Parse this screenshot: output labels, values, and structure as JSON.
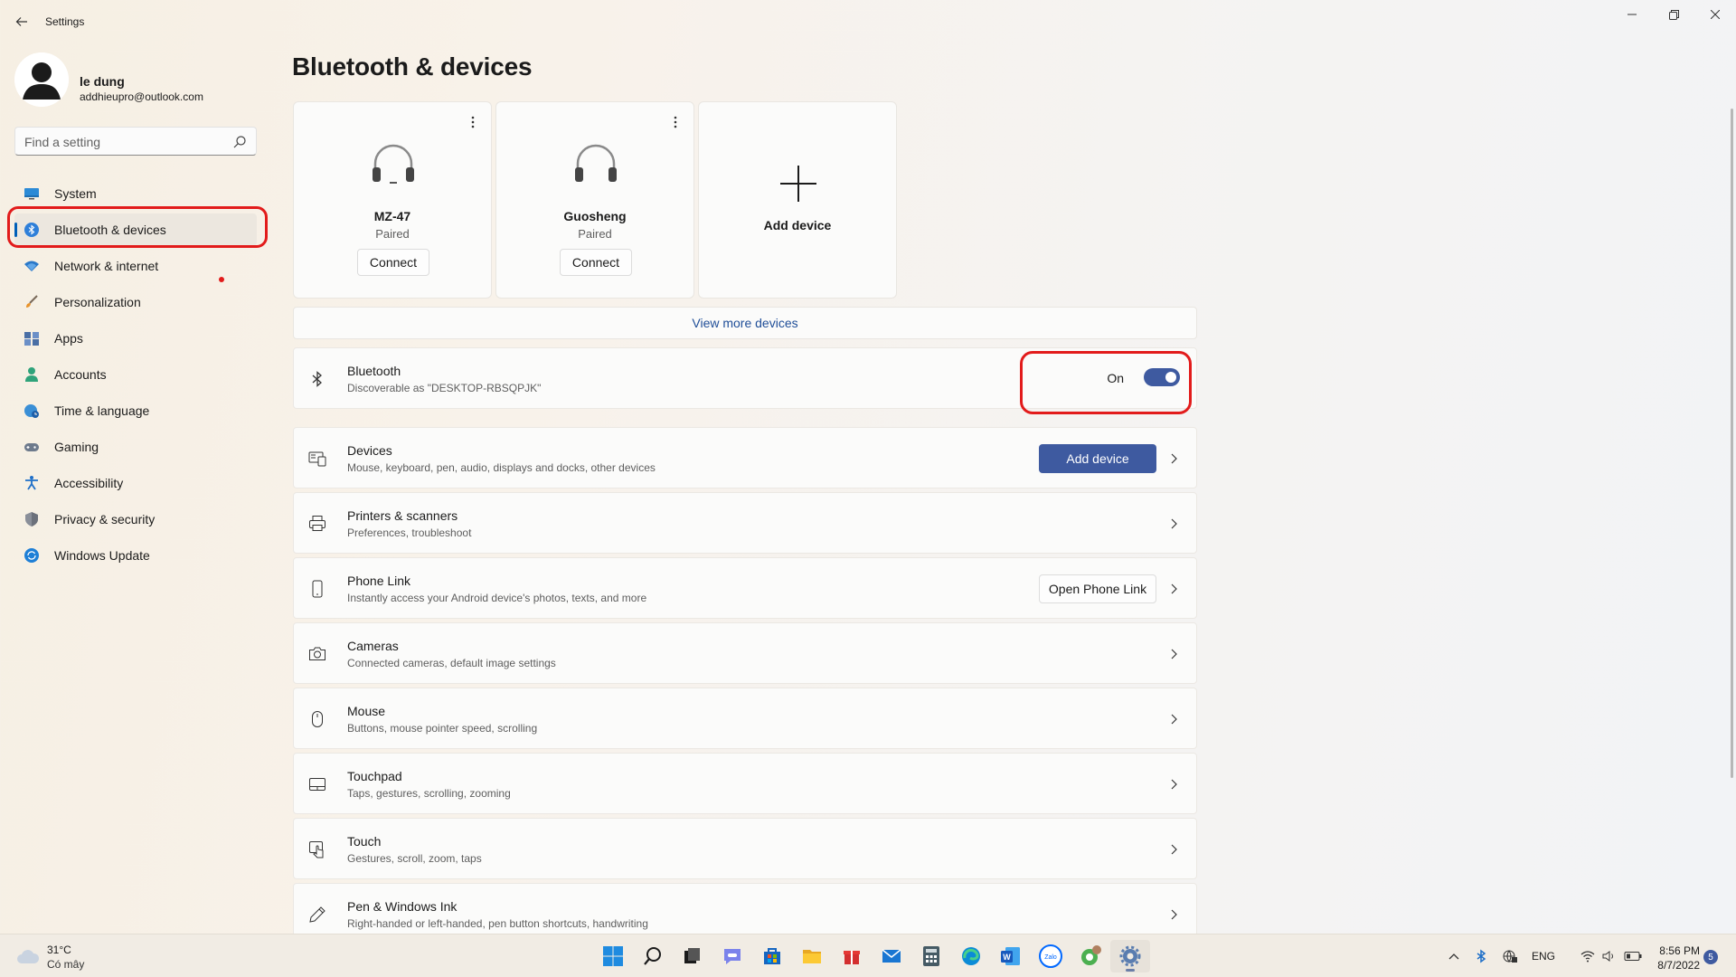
{
  "window": {
    "title": "Settings"
  },
  "profile": {
    "name": "le dung",
    "email": "addhieupro@outlook.com"
  },
  "search": {
    "placeholder": "Find a setting"
  },
  "nav": [
    {
      "label": "System",
      "icon": "monitor-icon"
    },
    {
      "label": "Bluetooth & devices",
      "icon": "bluetooth-icon",
      "active": true
    },
    {
      "label": "Network & internet",
      "icon": "wifi-icon"
    },
    {
      "label": "Personalization",
      "icon": "brush-icon"
    },
    {
      "label": "Apps",
      "icon": "apps-icon"
    },
    {
      "label": "Accounts",
      "icon": "person-icon"
    },
    {
      "label": "Time & language",
      "icon": "globe-clock-icon"
    },
    {
      "label": "Gaming",
      "icon": "gamepad-icon"
    },
    {
      "label": "Accessibility",
      "icon": "accessibility-icon"
    },
    {
      "label": "Privacy & security",
      "icon": "shield-icon"
    },
    {
      "label": "Windows Update",
      "icon": "update-icon"
    }
  ],
  "page": {
    "title": "Bluetooth & devices"
  },
  "devices": [
    {
      "name": "MZ-47",
      "status": "Paired",
      "button": "Connect"
    },
    {
      "name": "Guosheng",
      "status": "Paired",
      "button": "Connect"
    }
  ],
  "add_card": {
    "label": "Add device"
  },
  "view_more": "View more devices",
  "bluetooth": {
    "title": "Bluetooth",
    "subtitle": "Discoverable as \"DESKTOP-RBSQPJK\"",
    "state": "On"
  },
  "rows": [
    {
      "title": "Devices",
      "subtitle": "Mouse, keyboard, pen, audio, displays and docks, other devices",
      "button": "Add device"
    },
    {
      "title": "Printers & scanners",
      "subtitle": "Preferences, troubleshoot"
    },
    {
      "title": "Phone Link",
      "subtitle": "Instantly access your Android device's photos, texts, and more",
      "button": "Open Phone Link"
    },
    {
      "title": "Cameras",
      "subtitle": "Connected cameras, default image settings"
    },
    {
      "title": "Mouse",
      "subtitle": "Buttons, mouse pointer speed, scrolling"
    },
    {
      "title": "Touchpad",
      "subtitle": "Taps, gestures, scrolling, zooming"
    },
    {
      "title": "Touch",
      "subtitle": "Gestures, scroll, zoom, taps"
    },
    {
      "title": "Pen & Windows Ink",
      "subtitle": "Right-handed or left-handed, pen button shortcuts, handwriting"
    }
  ],
  "taskbar": {
    "weather_temp": "31°C",
    "weather_desc": "Có mây",
    "language": "ENG",
    "time": "8:56 PM",
    "date": "8/7/2022",
    "notification_count": "5",
    "zalo_label": "Zalo",
    "word_label": "W"
  },
  "colors": {
    "accent": "#3e5aa0",
    "annotation_red": "#e21b1b"
  }
}
